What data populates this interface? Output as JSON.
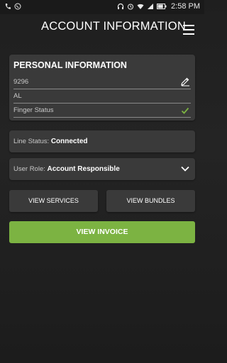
{
  "status_bar": {
    "time": "2:58 PM",
    "battery_percent": 0.8,
    "icons": [
      "phone-icon",
      "whatsapp-icon",
      "headphones-icon",
      "alarm-icon",
      "wifi-icon",
      "signal-icon",
      "battery-icon"
    ]
  },
  "header": {
    "title": "ACCOUNT INFORMATION",
    "menu_icon": "hamburger-menu-icon"
  },
  "personal_info": {
    "title": "PERSONAL INFORMATION",
    "fields": [
      {
        "value": "9296"
      },
      {
        "value": "AL"
      },
      {
        "value": "Finger Status",
        "status": "verified"
      }
    ]
  },
  "line_status": {
    "label": "Line Status:",
    "value": "Connected"
  },
  "user_role": {
    "label": "User Role:",
    "value": "Account Responsible"
  },
  "buttons": {
    "view_services": "VIEW SERVICES",
    "view_bundles": "VIEW BUNDLES",
    "view_invoice": "VIEW INVOICE"
  },
  "colors": {
    "accent": "#7cb342",
    "card": "#3a3a3a",
    "background": "#222222"
  }
}
